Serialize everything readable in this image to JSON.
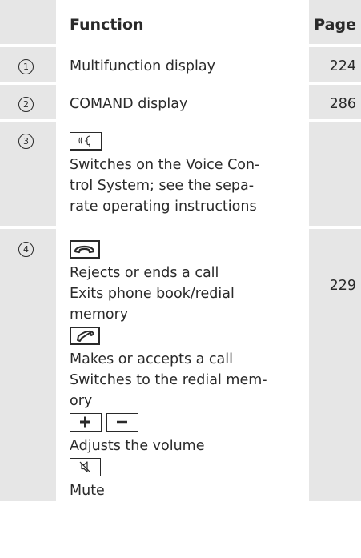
{
  "header": {
    "function": "Function",
    "page": "Page"
  },
  "rows": [
    {
      "num": "1",
      "label": "Multifunction display",
      "page": "224"
    },
    {
      "num": "2",
      "label": "COMAND display",
      "page": "286"
    },
    {
      "num": "3",
      "lines": [
        "Switches on the Voice Con-",
        "trol System; see the sepa-",
        "rate operating instructions"
      ],
      "page": ""
    },
    {
      "num": "4",
      "end_lines": [
        "Rejects or ends a call",
        "Exits phone book/redial",
        "memory"
      ],
      "call_lines": [
        "Makes or accepts a call",
        "Switches to the redial mem-",
        "ory"
      ],
      "volume_line": "Adjusts the volume",
      "mute_line": "Mute",
      "page": "229"
    }
  ],
  "icons": {
    "voice": "voice-control-key-icon",
    "end_call": "end-call-key-icon",
    "accept_call": "accept-call-key-icon",
    "volume_up": "volume-up-key-icon",
    "volume_down": "volume-down-key-icon",
    "mute": "mute-key-icon"
  }
}
